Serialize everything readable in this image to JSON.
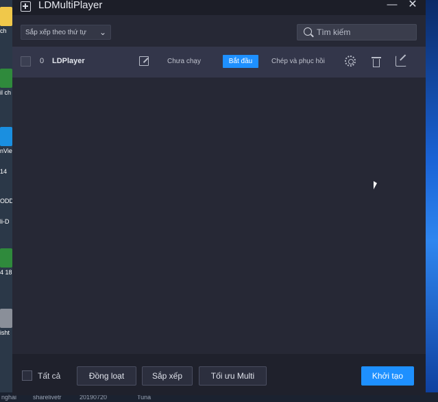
{
  "window": {
    "title": "LDMultiPlayer",
    "minimize_glyph": "—",
    "close_glyph": "✕"
  },
  "toolbar": {
    "sort_label": "Sắp xếp theo thứ tự",
    "search_placeholder": "Tìm kiếm"
  },
  "players": [
    {
      "index": "0",
      "name": "LDPlayer",
      "status": "Chưa chạy",
      "start_label": "Bắt đầu",
      "copy_label": "Chép và phục hồi"
    }
  ],
  "footer": {
    "select_all_label": "Tất cả",
    "batch_label": "Đồng loạt",
    "arrange_label": "Sắp xếp",
    "optimize_label": "Tối ưu Multi",
    "create_label": "Khởi tạo"
  },
  "desktop": {
    "icon_texts": [
      "ch",
      "il ch",
      "nVie",
      "14",
      "ODD",
      "li-D",
      "4 18",
      "isht"
    ],
    "taskbar_texts": [
      "nghai",
      "sharelivetr",
      "20190720",
      "Tuna"
    ]
  },
  "colors": {
    "accent": "#1e90ff",
    "window_bg": "#262835",
    "row_bg": "#33364a"
  },
  "icons": [
    "app-icon",
    "edit-icon",
    "gear-icon",
    "trash-icon",
    "share-icon",
    "search-icon",
    "chevron-down-icon"
  ]
}
